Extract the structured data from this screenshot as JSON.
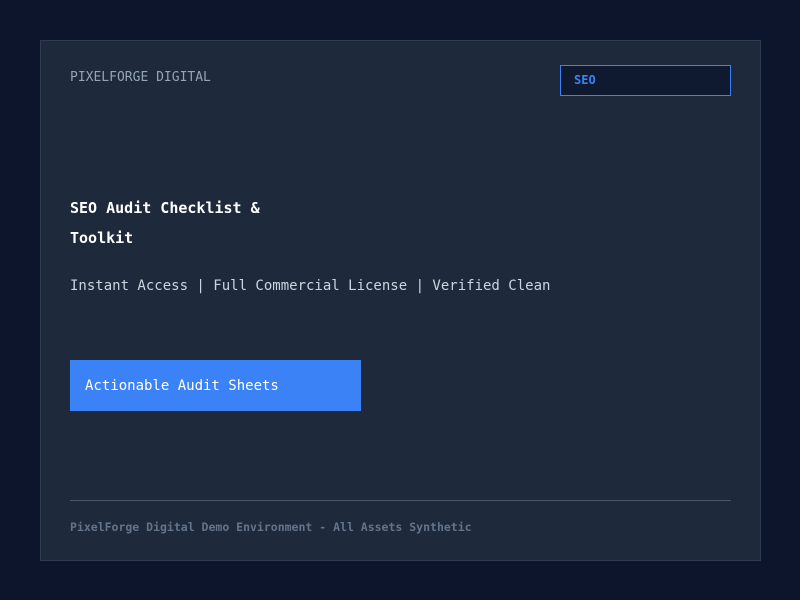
{
  "header": {
    "brand": "PIXELFORGE DIGITAL",
    "tag": "SEO"
  },
  "hero": {
    "title": "SEO Audit Checklist & Toolkit",
    "subtitle": "Instant Access | Full Commercial License | Verified Clean",
    "cta_label": "Actionable Audit Sheets"
  },
  "footer": {
    "text": "PixelForge Digital Demo Environment - All Assets Synthetic"
  },
  "colors": {
    "background": "#0c152b",
    "panel": "#1e293b",
    "accent": "#3b82f6"
  }
}
